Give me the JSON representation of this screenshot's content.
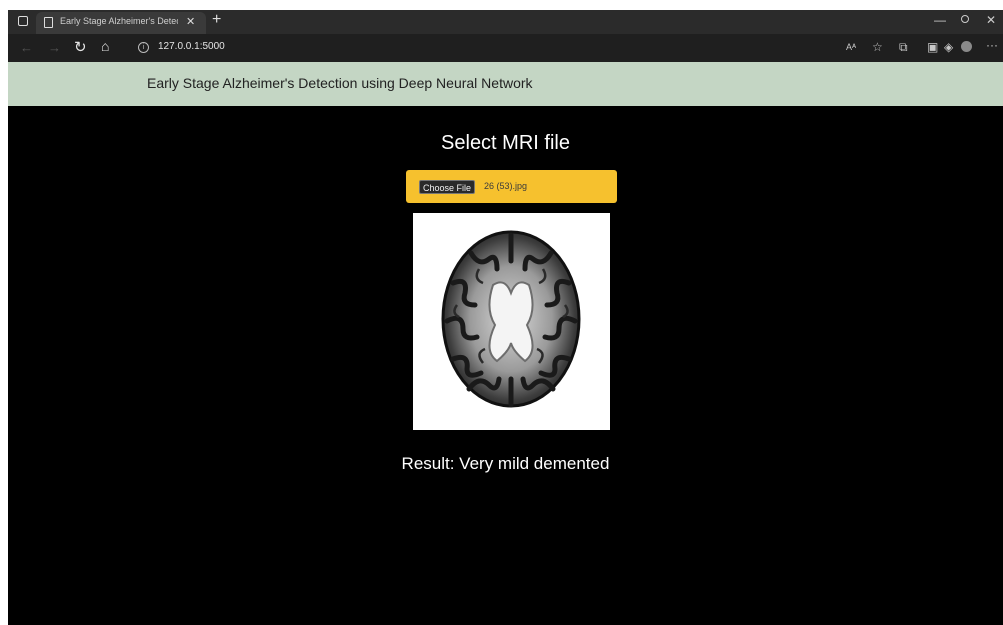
{
  "browser": {
    "tab_title": "Early Stage Alzheimer's Detectio",
    "url": "127.0.0.1:5000",
    "icons": [
      "tab-actions-icon",
      "document-icon",
      "close-icon",
      "new-tab-icon",
      "back-icon",
      "forward-icon",
      "refresh-icon",
      "home-icon",
      "info-icon",
      "read-aloud-icon",
      "add-favorite-icon",
      "collections-icon",
      "screenshot-icon",
      "extensions-icon",
      "profile-icon",
      "more-icon",
      "minimize-icon",
      "maximize-icon",
      "window-close-icon"
    ]
  },
  "page": {
    "header_title": "Early Stage Alzheimer's Detection using Deep Neural Network",
    "select_title": "Select MRI file",
    "choose_file_label": "Choose File",
    "selected_file": "26 (53).jpg",
    "result_text": "Result: Very mild demented"
  },
  "colors": {
    "header_bg": "#c4d6c4",
    "upload_box": "#f6c12e",
    "page_bg": "#000000"
  }
}
